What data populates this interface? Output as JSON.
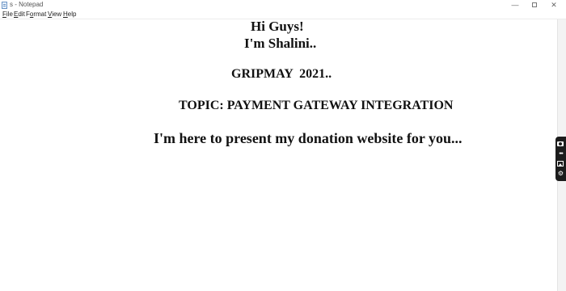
{
  "window": {
    "title": "s - Notepad",
    "minimize_glyph": "—",
    "close_glyph": "✕"
  },
  "menubar": {
    "file": {
      "accel": "F",
      "rest": "ile"
    },
    "edit": {
      "accel": "E",
      "rest": "dit"
    },
    "format": {
      "pre": "F",
      "accel": "o",
      "rest": "rmat"
    },
    "view": {
      "accel": "V",
      "rest": "iew"
    },
    "help": {
      "accel": "H",
      "rest": "elp"
    }
  },
  "document": {
    "lines": [
      "Hi Guys!",
      "I'm Shalini..",
      "GRIPMAY  2021..",
      "TOPIC: PAYMENT GATEWAY INTEGRATION",
      "I'm here to present my donation website for you..."
    ]
  },
  "side_toolbar": {
    "icons": [
      "camera-icon",
      "more-icon",
      "gallery-icon",
      "settings-icon"
    ],
    "more_glyph": "•••",
    "settings_glyph": "⚙"
  },
  "colors": {
    "text": "#111111",
    "toolbar_bg": "#1c1c1c"
  }
}
